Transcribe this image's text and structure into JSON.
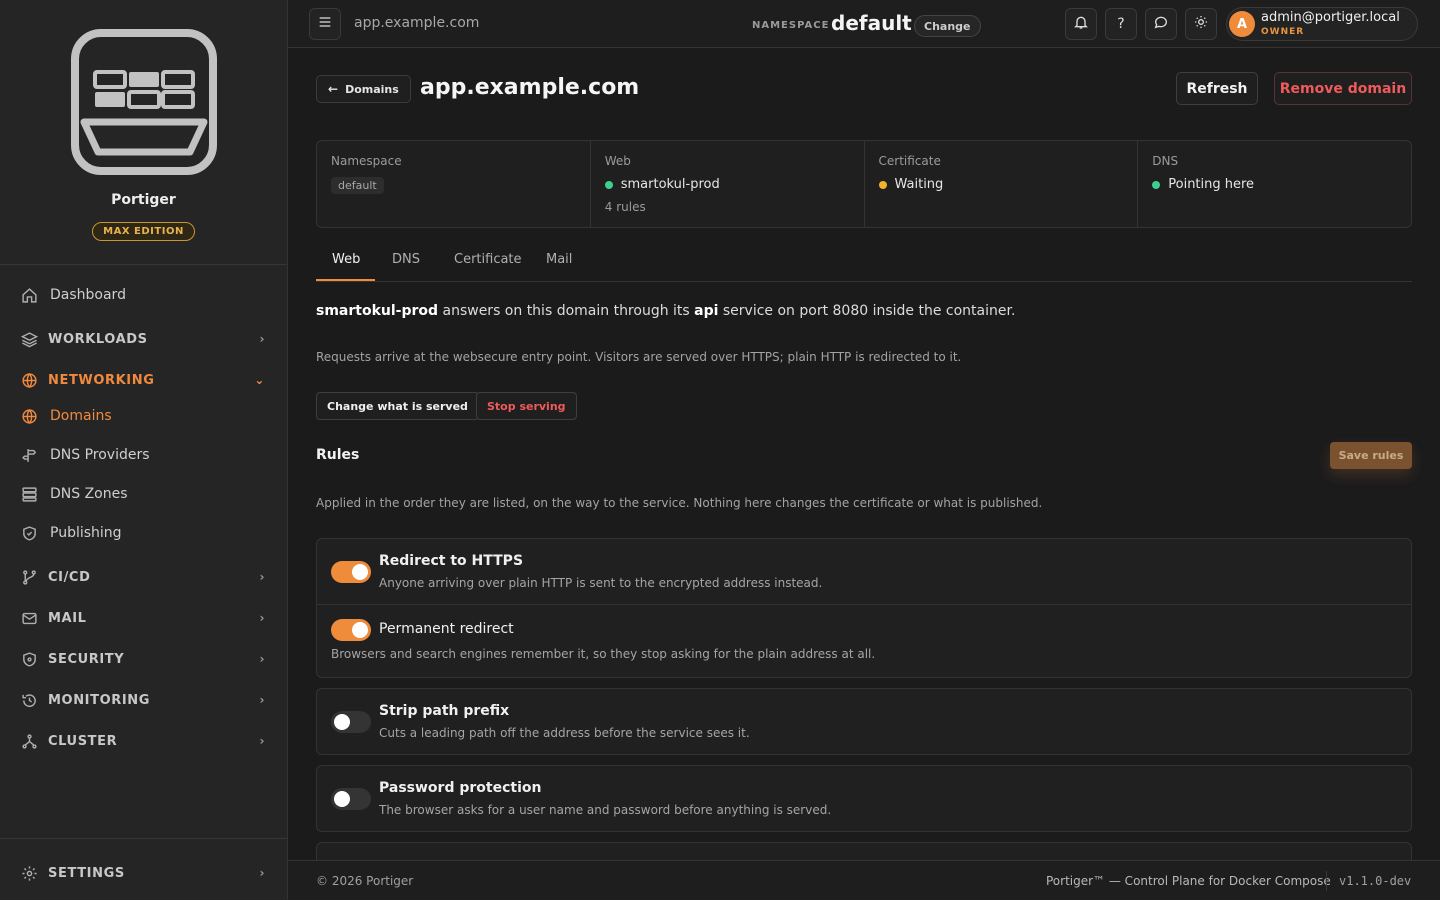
{
  "sidebar": {
    "brand_name": "Portiger",
    "edition": "MAX EDITION",
    "nav": {
      "dashboard": "Dashboard",
      "workloads": "WORKLOADS",
      "networking": "NETWORKING",
      "domains": "Domains",
      "dns_providers": "DNS Providers",
      "dns_zones": "DNS Zones",
      "publishing": "Publishing",
      "cicd": "CI/CD",
      "mail": "MAIL",
      "security": "SECURITY",
      "monitoring": "MONITORING",
      "cluster": "CLUSTER",
      "settings": "SETTINGS"
    }
  },
  "topbar": {
    "host": "app.example.com",
    "namespace_label": "NAMESPACE",
    "namespace_value": "default",
    "change_label": "Change",
    "help_label": "?",
    "user": {
      "avatar_letter": "A",
      "email": "admin@portiger.local",
      "role": "OWNER"
    }
  },
  "header": {
    "back_label": "Domains",
    "title": "app.example.com",
    "refresh_label": "Refresh",
    "remove_label": "Remove domain"
  },
  "info": {
    "namespace": {
      "label": "Namespace",
      "value": "default"
    },
    "web": {
      "label": "Web",
      "value": "smartokul-prod",
      "sub": "4 rules",
      "status_color": "#3ecf8e"
    },
    "certificate": {
      "label": "Certificate",
      "value": "Waiting",
      "status_color": "#f0b429"
    },
    "dns": {
      "label": "DNS",
      "value": "Pointing here",
      "status_color": "#3ecf8e"
    }
  },
  "tabs": {
    "web": "Web",
    "dns": "DNS",
    "certificate": "Certificate",
    "mail": "Mail"
  },
  "web": {
    "lead": {
      "project": "smartokul-prod",
      "part1": " answers on this domain through its ",
      "service": "api",
      "part2": " service on port 8080 inside the container."
    },
    "note": "Requests arrive at the websecure entry point. Visitors are served over HTTPS; plain HTTP is redirected to it.",
    "change_label": "Change what is served",
    "stop_label": "Stop serving"
  },
  "rules": {
    "title": "Rules",
    "save_label": "Save rules",
    "note": "Applied in the order they are listed, on the way to the service. Nothing here changes the certificate or what is published.",
    "items": [
      {
        "title": "Redirect to HTTPS",
        "desc": "Anyone arriving over plain HTTP is sent to the encrypted address instead.",
        "enabled": true
      },
      {
        "title": "Permanent redirect",
        "desc": "Browsers and search engines remember it, so they stop asking for the plain address at all.",
        "enabled": true
      },
      {
        "title": "Strip path prefix",
        "desc": "Cuts a leading path off the address before the service sees it.",
        "enabled": false
      },
      {
        "title": "Password protection",
        "desc": "The browser asks for a user name and password before anything is served.",
        "enabled": false
      }
    ]
  },
  "footer": {
    "copyright": "© 2026 Portiger",
    "tagline": "Portiger™ — Control Plane for Docker Compose",
    "version": "v1.1.0-dev"
  },
  "colors": {
    "accent": "#ee8c3c",
    "danger": "#ef5a5a",
    "success": "#3ecf8e",
    "warning": "#f0b429"
  }
}
